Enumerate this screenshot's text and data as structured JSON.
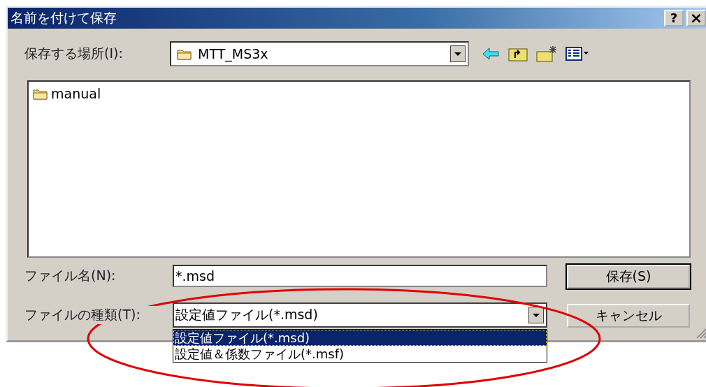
{
  "window": {
    "title": "名前を付けて保存",
    "buttons": [
      {
        "kind": "help",
        "label": "?"
      },
      {
        "kind": "close",
        "label": "×"
      }
    ]
  },
  "location": {
    "label": "保存する場所(I):",
    "value": "MTT_MS3x"
  },
  "files": [
    {
      "name": "manual",
      "selected": false
    }
  ],
  "filename": {
    "label": "ファイル名(N):",
    "value": "*.msd"
  },
  "filetype": {
    "label": "ファイルの種類(T):",
    "value": "設定値ファイル(*.msd)",
    "expanded": true,
    "options": [
      {
        "label": "設定値ファイル(*.msd)",
        "selected": true
      },
      {
        "label": "設定値＆係数ファイル(*.msf)",
        "selected": false
      }
    ]
  },
  "buttons": [
    {
      "label": "保存(S)",
      "default": true
    },
    {
      "label": "キャンセル",
      "default": false
    }
  ],
  "annotation": {
    "kind": "ellipse"
  }
}
